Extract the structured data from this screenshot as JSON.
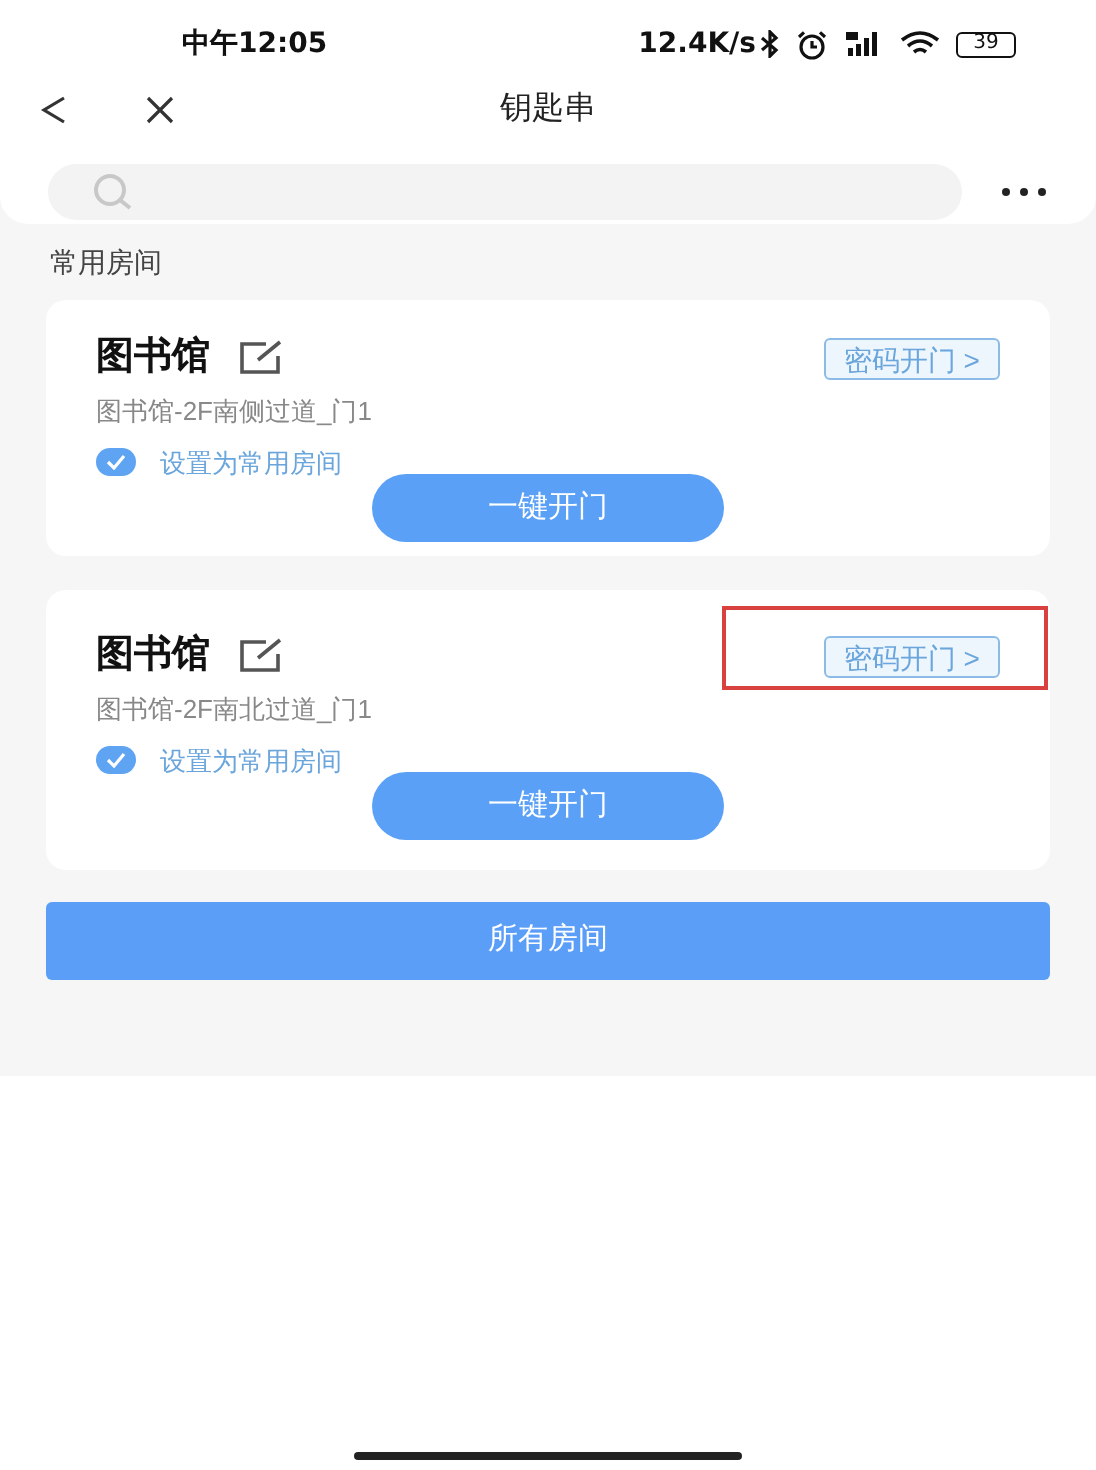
{
  "status_bar": {
    "time": "中午12:05",
    "speed": "12.4K/s",
    "battery": "39"
  },
  "nav": {
    "title": "钥匙串"
  },
  "section_title": "常用房间",
  "rooms": [
    {
      "name": "图书馆",
      "door": "图书馆-2F南侧过道_门1",
      "password_button": "密码开门 >",
      "favorite_label": "设置为常用房间",
      "favorite": true,
      "open_button": "一键开门",
      "highlighted": false
    },
    {
      "name": "图书馆",
      "door": "图书馆-2F南北过道_门1",
      "password_button": "密码开门 >",
      "favorite_label": "设置为常用房间",
      "favorite": true,
      "open_button": "一键开门",
      "highlighted": true
    }
  ],
  "all_rooms_button": "所有房间"
}
